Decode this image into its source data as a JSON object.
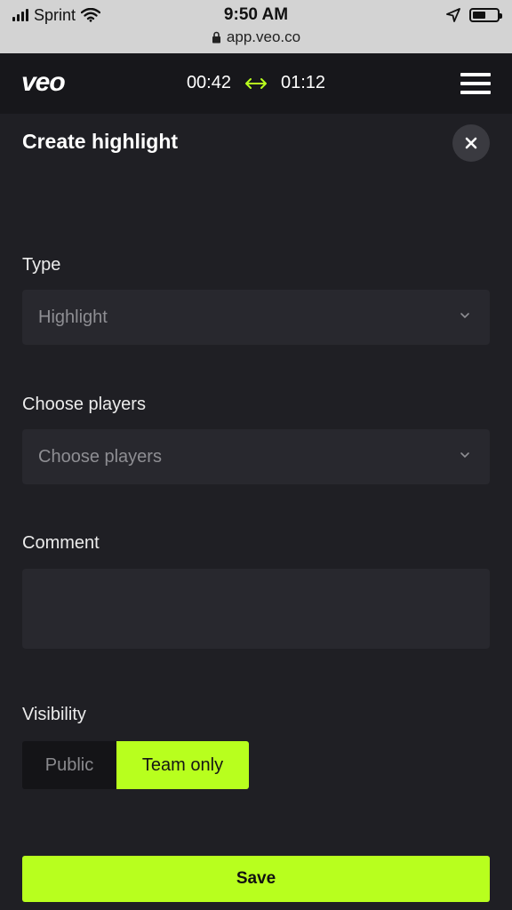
{
  "status_bar": {
    "carrier": "Sprint",
    "time": "9:50 AM",
    "url": "app.veo.co",
    "battery_level": 0.55,
    "icons": [
      "signal-icon",
      "wifi-icon",
      "location-arrow-icon",
      "battery-icon",
      "lock-icon"
    ]
  },
  "header": {
    "logo": "veo",
    "start_time": "00:42",
    "end_time": "01:12",
    "range_icon": "double-arrow-icon",
    "menu_icon": "hamburger-icon"
  },
  "panel": {
    "title": "Create highlight",
    "close_icon": "close-icon"
  },
  "form": {
    "type_label": "Type",
    "type_value": "Highlight",
    "players_label": "Choose players",
    "players_placeholder": "Choose players",
    "comment_label": "Comment",
    "comment_value": "",
    "visibility_label": "Visibility",
    "visibility_options": [
      "Public",
      "Team only"
    ],
    "visibility_selected": "Team only"
  },
  "actions": {
    "save_label": "Save"
  },
  "colors": {
    "accent": "#b8ff1e",
    "background": "#1f1f24",
    "header_background": "#17171b",
    "field_background": "#28282e",
    "status_bar": "#d3d3d3"
  }
}
